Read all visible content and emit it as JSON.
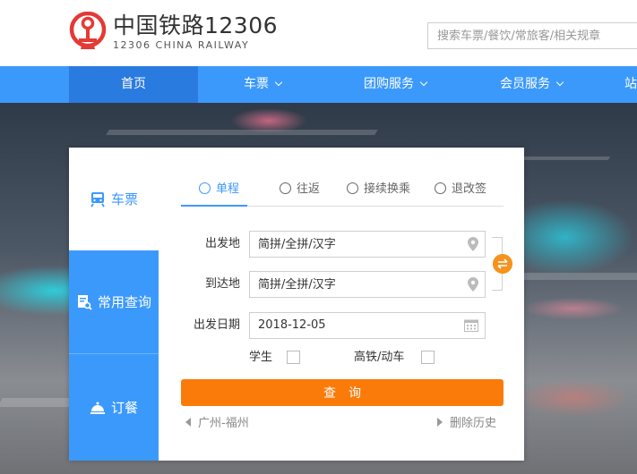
{
  "header": {
    "logo_cn": "中国铁路12306",
    "logo_en": "12306 CHINA RAILWAY",
    "search_placeholder": "搜索车票/餐饮/常旅客/相关规章"
  },
  "nav": {
    "items": [
      {
        "label": "首页"
      },
      {
        "label": "车票"
      },
      {
        "label": "团购服务"
      },
      {
        "label": "会员服务"
      },
      {
        "label": "站"
      }
    ]
  },
  "side_tabs": [
    {
      "label": "车票"
    },
    {
      "label": "常用查询"
    },
    {
      "label": "订餐"
    }
  ],
  "trip_tabs": [
    {
      "label": "单程"
    },
    {
      "label": "往返"
    },
    {
      "label": "接续换乘"
    },
    {
      "label": "退改签"
    }
  ],
  "form": {
    "from_label": "出发地",
    "from_placeholder": "简拼/全拼/汉字",
    "to_label": "到达地",
    "to_placeholder": "简拼/全拼/汉字",
    "date_label": "出发日期",
    "date_value": "2018-12-05",
    "student_label": "学生",
    "highspeed_label": "高铁/动车",
    "query_label": "查询"
  },
  "history": {
    "recent": "广州-福州",
    "clear": "删除历史"
  },
  "colors": {
    "brand_blue": "#3b99fc",
    "nav_active": "#2a7be0",
    "query_orange": "#fb7b0a",
    "swap_orange": "#f6921e",
    "logo_red": "#e53935"
  }
}
